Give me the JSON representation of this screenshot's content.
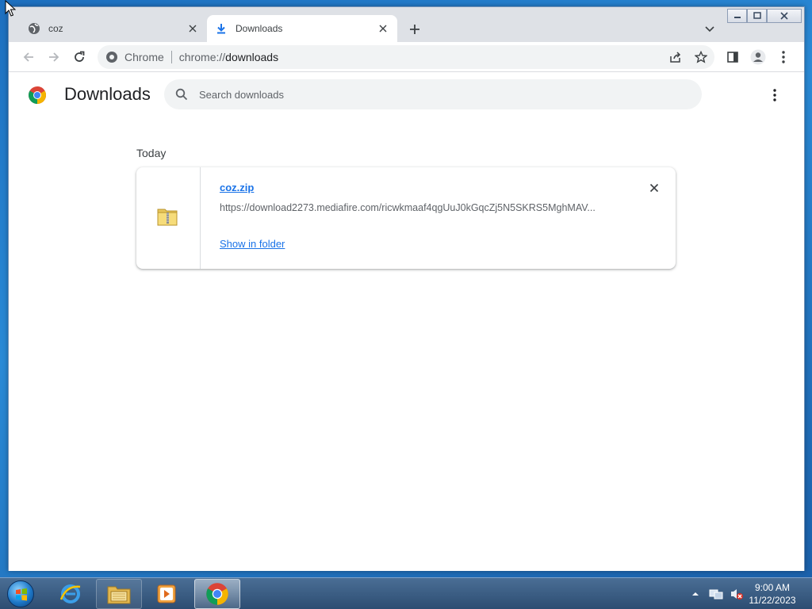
{
  "browser": {
    "tabs": [
      {
        "label": "coz",
        "active": false,
        "icon": "globe-icon"
      },
      {
        "label": "Downloads",
        "active": true,
        "icon": "download-icon"
      }
    ],
    "address_bar": {
      "site_name": "Chrome",
      "url_scheme": "chrome://",
      "url_host": "downloads"
    }
  },
  "downloads_page": {
    "title": "Downloads",
    "search_placeholder": "Search downloads",
    "section_label": "Today",
    "items": [
      {
        "file_name": "coz.zip",
        "url": "https://download2273.mediafire.com/ricwkmaaf4qgUuJ0kGqcZj5N5SKRS5MghMAV...",
        "action_label": "Show in folder",
        "icon": "zip-folder-icon"
      }
    ]
  },
  "taskbar": {
    "apps": [
      "internet-explorer",
      "file-explorer",
      "media-player",
      "chrome"
    ],
    "clock_time": "9:00 AM",
    "clock_date": "11/22/2023"
  },
  "colors": {
    "link_blue": "#1a73e8",
    "tab_strip": "#dee1e6",
    "omnibox_bg": "#f1f3f4"
  }
}
